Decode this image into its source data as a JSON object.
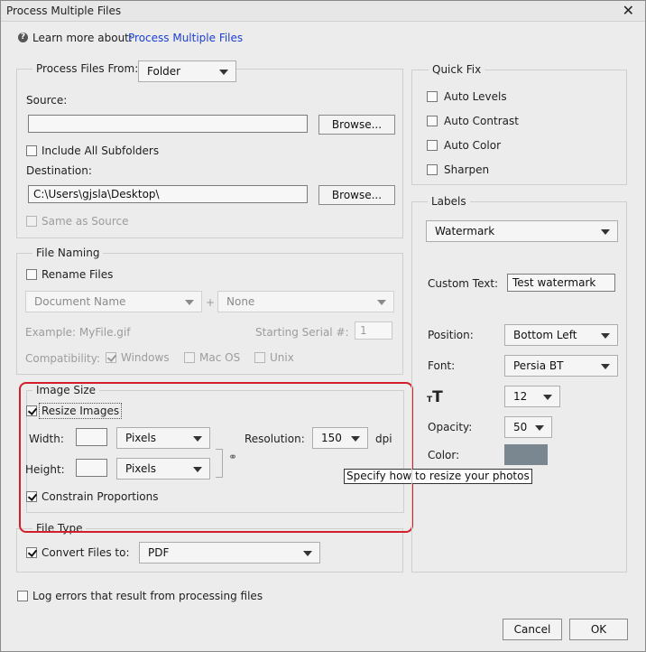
{
  "window": {
    "title": "Process Multiple Files"
  },
  "help": {
    "prefix": "Learn more about:",
    "link": "Process Multiple Files"
  },
  "process_from": {
    "legend": "Process Files From:",
    "dropdown": "Folder",
    "source_label": "Source:",
    "source_value": "",
    "browse_label": "Browse...",
    "include_subfolders": "Include All Subfolders",
    "destination_label": "Destination:",
    "destination_value": "C:\\Users\\gjsla\\Desktop\\",
    "same_as_source": "Same as Source"
  },
  "file_naming": {
    "legend": "File Naming",
    "rename": "Rename Files",
    "name_select": "Document Name",
    "plus": "+",
    "suffix_select": "None",
    "example": "Example: MyFile.gif",
    "serial_label": "Starting Serial #:",
    "serial_value": "1",
    "compat_label": "Compatibility:",
    "windows": "Windows",
    "macos": "Mac OS",
    "unix": "Unix"
  },
  "image_size": {
    "legend": "Image Size",
    "resize": "Resize Images",
    "width_label": "Width:",
    "height_label": "Height:",
    "width_unit": "Pixels",
    "height_unit": "Pixels",
    "resolution_label": "Resolution:",
    "resolution_value": "150",
    "dpi": "dpi",
    "constrain": "Constrain Proportions",
    "tooltip": "Specify how to resize your photos"
  },
  "file_type": {
    "legend": "File Type",
    "convert": "Convert Files to:",
    "format": "PDF"
  },
  "log_errors": "Log errors that result from processing files",
  "quick_fix": {
    "legend": "Quick Fix",
    "items": [
      "Auto Levels",
      "Auto Contrast",
      "Auto Color",
      "Sharpen"
    ]
  },
  "labels": {
    "legend": "Labels",
    "type": "Watermark",
    "custom_text_label": "Custom Text:",
    "custom_text_value": "Test watermark",
    "position_label": "Position:",
    "position_value": "Bottom Left",
    "font_label": "Font:",
    "font_value": "Persia BT",
    "size_icon": "font-size-icon",
    "size_value": "12",
    "opacity_label": "Opacity:",
    "opacity_value": "50",
    "color_label": "Color:",
    "color_value": "#7a8690"
  },
  "buttons": {
    "cancel": "Cancel",
    "ok": "OK"
  },
  "colors": {
    "link": "#1c3fcf",
    "highlight": "#d21f2a"
  }
}
